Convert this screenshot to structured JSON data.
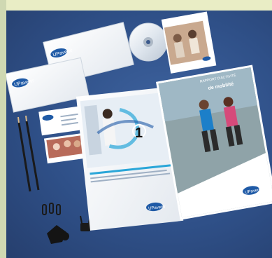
{
  "brand": {
    "logo_text": "UPavenir",
    "primary_color": "#1f5aa6",
    "accent_color": "#2aa6d8",
    "background_color": "#2f5088"
  },
  "overlay": {
    "marker_label": "1"
  },
  "report": {
    "title_line1": "RAPPORT D'ACTIVITÉ",
    "title_line2": "de mobilité"
  }
}
